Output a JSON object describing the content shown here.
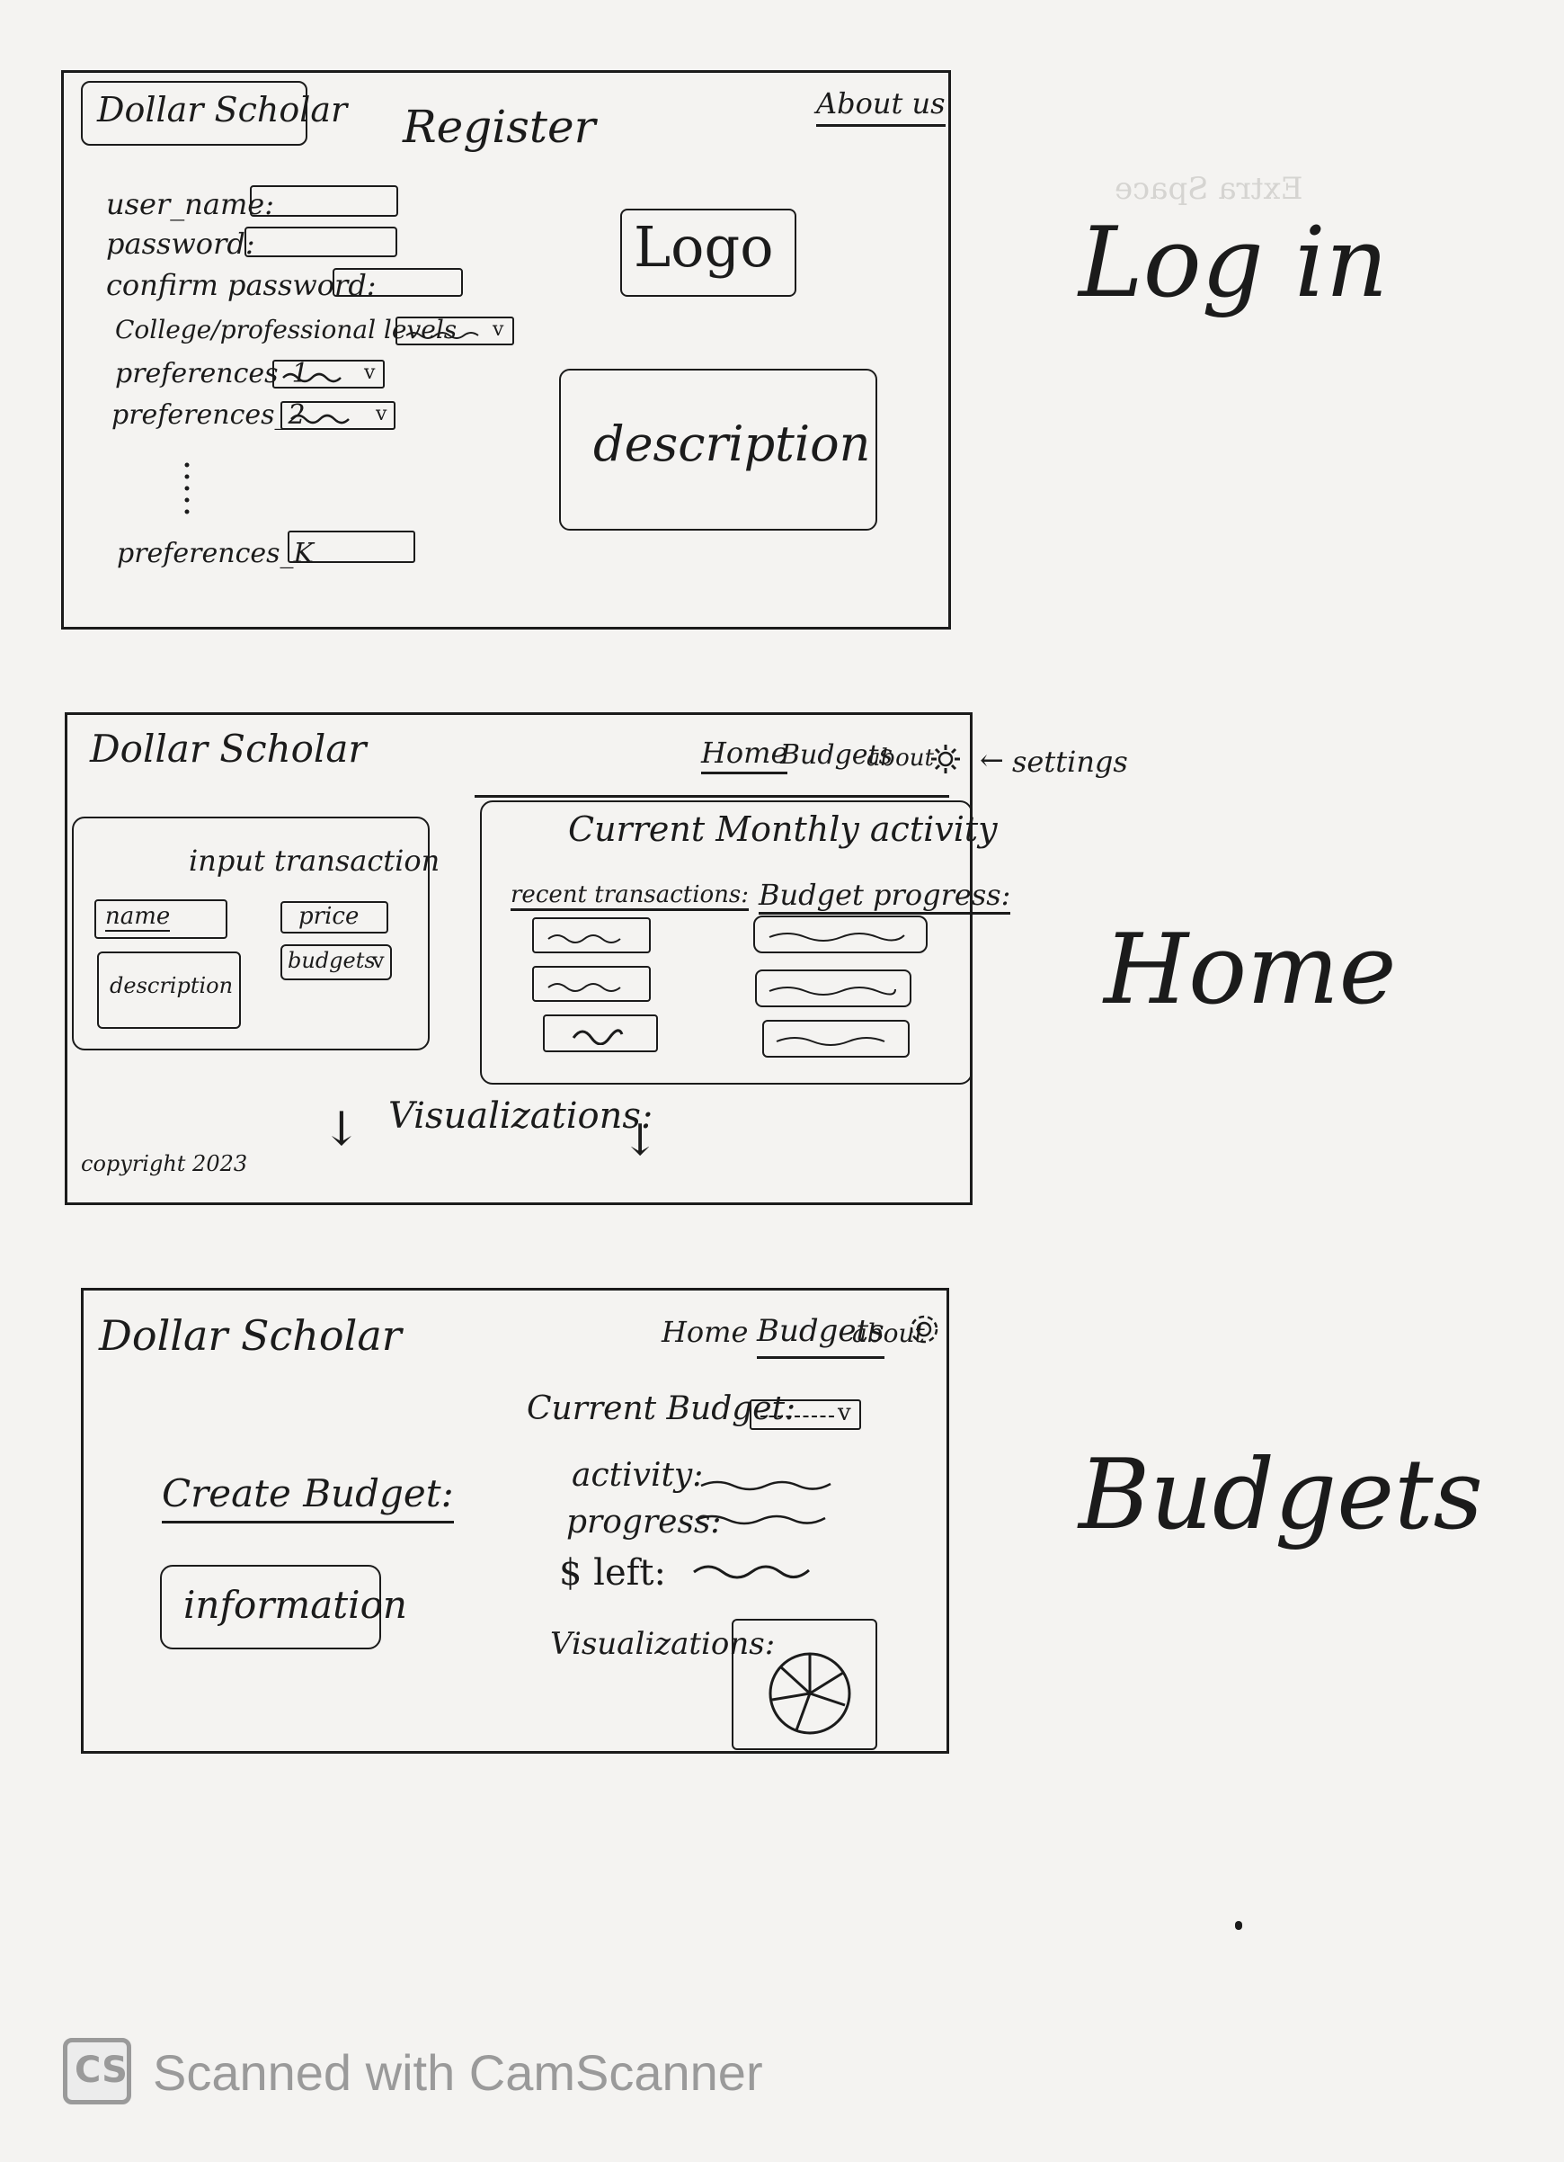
{
  "login_screen": {
    "brand": "Dollar Scholar",
    "title": "Register",
    "about_link": "About us",
    "fields": {
      "username": "user_name:",
      "password": "password:",
      "confirm_password": "confirm password:",
      "level": "College/professional levels",
      "pref1": "preferences_1",
      "pref2": "preferences_2",
      "prefk": "preferences_K"
    },
    "logo": "Logo",
    "description": "description",
    "side_label": "Log in"
  },
  "home_screen": {
    "brand": "Dollar Scholar",
    "nav": {
      "home": "Home",
      "budgets": "Budgets",
      "about": "about"
    },
    "settings_label": "settings",
    "input_panel_title": "input transaction",
    "input_fields": {
      "name": "name",
      "price": "price",
      "budgets": "budgets",
      "description": "description"
    },
    "activity_title": "Current Monthly activity",
    "recent_transactions": "recent transactions:",
    "budget_progress": "Budget progress:",
    "visualizations": "Visualizations:",
    "copyright": "copyright 2023",
    "side_label": "Home"
  },
  "budgets_screen": {
    "brand": "Dollar Scholar",
    "nav": {
      "home": "Home",
      "budgets": "Budgets",
      "about": "about"
    },
    "current_budget": "Current Budget:",
    "activity": "activity:",
    "progress": "progress:",
    "left": "$ left:",
    "visualizations": "Visualizations:",
    "create_budget": "Create Budget:",
    "information": "information",
    "side_label": "Budgets"
  },
  "ghost_text": {
    "line1": "Extra Space"
  },
  "watermark": {
    "badge": "CS",
    "text": "Scanned with CamScanner"
  },
  "colors": {
    "ink": "#1b1b1b",
    "paper": "#f4f3f1",
    "watermark": "#9a9a9a"
  }
}
